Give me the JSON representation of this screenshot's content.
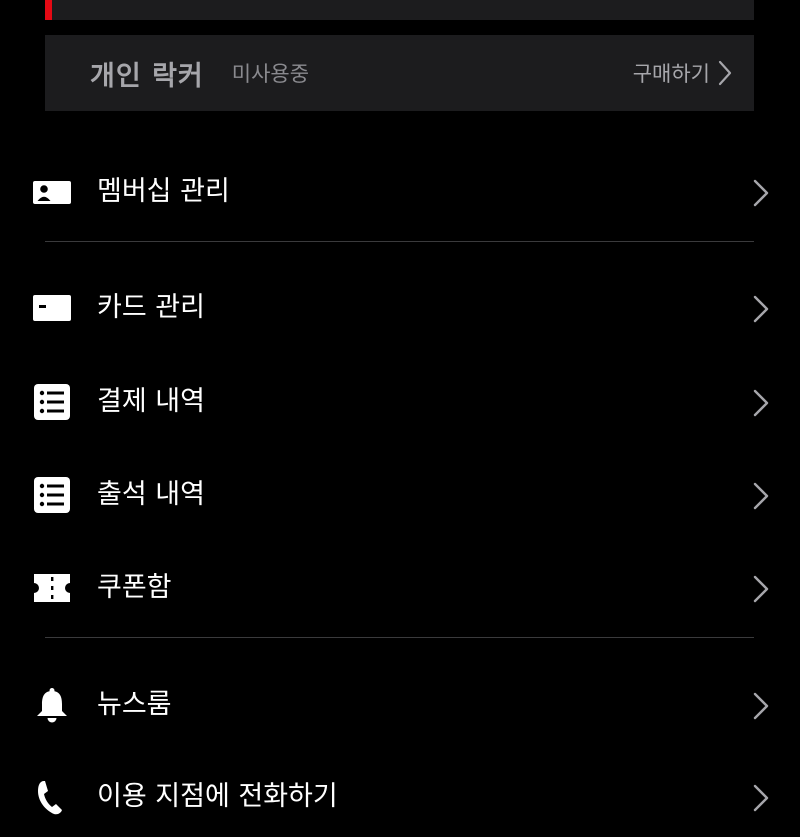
{
  "locker": {
    "title": "개인 락커",
    "status": "미사용중",
    "buy_label": "구매하기"
  },
  "menu": {
    "items": [
      {
        "label": "멤버십 관리",
        "icon": "member-card-icon"
      },
      {
        "label": "카드 관리",
        "icon": "card-icon"
      },
      {
        "label": "결제 내역",
        "icon": "list-icon"
      },
      {
        "label": "출석 내역",
        "icon": "list-icon"
      },
      {
        "label": "쿠폰함",
        "icon": "coupon-icon"
      },
      {
        "label": "뉴스룸",
        "icon": "bell-icon"
      },
      {
        "label": "이용 지점에 전화하기",
        "icon": "phone-icon"
      }
    ]
  },
  "colors": {
    "background": "#000000",
    "card": "#1c1c1e",
    "accent": "#e50914",
    "divider": "#3a3a3c",
    "text": "#ffffff",
    "muted": "#a6a6ab"
  }
}
